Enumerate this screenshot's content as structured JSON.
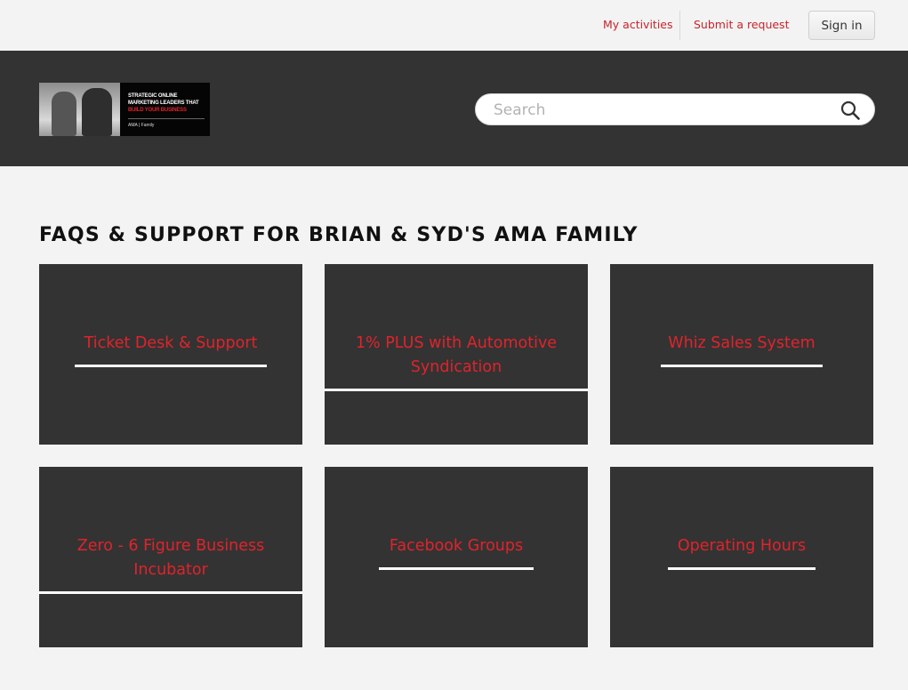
{
  "topbar": {
    "my_activities": "My activities",
    "submit_request": "Submit a request",
    "sign_in": "Sign in"
  },
  "header": {
    "logo": {
      "line1": "STRATEGIC ONLINE",
      "line2": "MARKETING LEADERS THAT",
      "line3": "BUILD YOUR BUSINESS",
      "small": "AMA | Family"
    },
    "search_placeholder": "Search"
  },
  "main": {
    "title": "FAQS & SUPPORT FOR BRIAN & SYD'S AMA FAMILY",
    "categories": [
      {
        "label": "Ticket Desk & Support"
      },
      {
        "label": "1% PLUS with Automotive Syndication"
      },
      {
        "label": "Whiz Sales System"
      },
      {
        "label": "Zero - 6 Figure Business Incubator"
      },
      {
        "label": "Facebook Groups"
      },
      {
        "label": "Operating Hours"
      }
    ]
  },
  "colors": {
    "accent": "#e0232b",
    "card_bg": "#333333",
    "page_bg": "#f3f3f3"
  }
}
